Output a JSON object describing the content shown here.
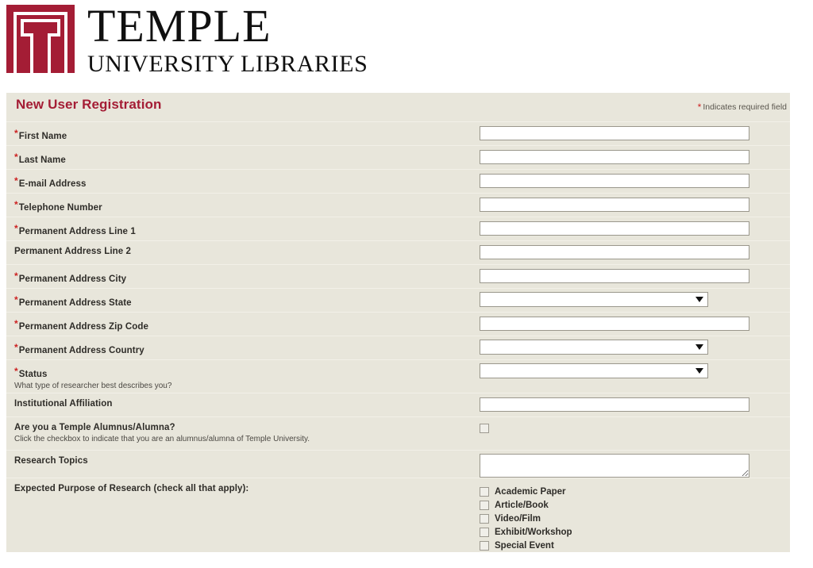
{
  "header": {
    "logo_mark_name": "temple-t-emblem",
    "wordmark_main": "TEMPLE",
    "wordmark_sub": "UNIVERSITY LIBRARIES",
    "brand_color": "#a41d35"
  },
  "form": {
    "title": "New User Registration",
    "required_note": "Indicates required field",
    "required_marker": "*",
    "accent_color": "#a41d35",
    "panel_bg": "#e8e6db",
    "fields": [
      {
        "label": "First Name",
        "required": true,
        "type": "text",
        "value": "",
        "hint": ""
      },
      {
        "label": "Last Name",
        "required": true,
        "type": "text",
        "value": "",
        "hint": ""
      },
      {
        "label": "E-mail Address",
        "required": true,
        "type": "text",
        "value": "",
        "hint": ""
      },
      {
        "label": "Telephone Number",
        "required": true,
        "type": "text",
        "value": "",
        "hint": ""
      },
      {
        "label": "Permanent Address Line 1",
        "required": true,
        "type": "text",
        "value": "",
        "hint": ""
      },
      {
        "label": "Permanent Address Line 2",
        "required": false,
        "type": "text",
        "value": "",
        "hint": ""
      },
      {
        "label": "Permanent Address City",
        "required": true,
        "type": "text",
        "value": "",
        "hint": ""
      },
      {
        "label": "Permanent Address State",
        "required": true,
        "type": "select",
        "value": "",
        "hint": ""
      },
      {
        "label": "Permanent Address Zip Code",
        "required": true,
        "type": "text",
        "value": "",
        "hint": ""
      },
      {
        "label": "Permanent Address Country",
        "required": true,
        "type": "select",
        "value": "",
        "hint": ""
      },
      {
        "label": "Status",
        "required": true,
        "type": "select",
        "value": "",
        "hint": "What type of researcher best describes you?"
      },
      {
        "label": "Institutional Affiliation",
        "required": false,
        "type": "text",
        "value": "",
        "hint": ""
      },
      {
        "label": "Are you a Temple Alumnus/Alumna?",
        "required": false,
        "type": "checkbox",
        "checked": false,
        "hint": "Click the checkbox to indicate that you are an alumnus/alumna of Temple University."
      },
      {
        "label": "Research Topics",
        "required": false,
        "type": "textarea",
        "value": "",
        "hint": ""
      }
    ],
    "purpose": {
      "label": "Expected Purpose of Research (check all that apply):",
      "options": [
        {
          "label": "Academic Paper",
          "checked": false
        },
        {
          "label": "Article/Book",
          "checked": false
        },
        {
          "label": "Video/Film",
          "checked": false
        },
        {
          "label": "Exhibit/Workshop",
          "checked": false
        },
        {
          "label": "Special Event",
          "checked": false
        }
      ]
    }
  }
}
